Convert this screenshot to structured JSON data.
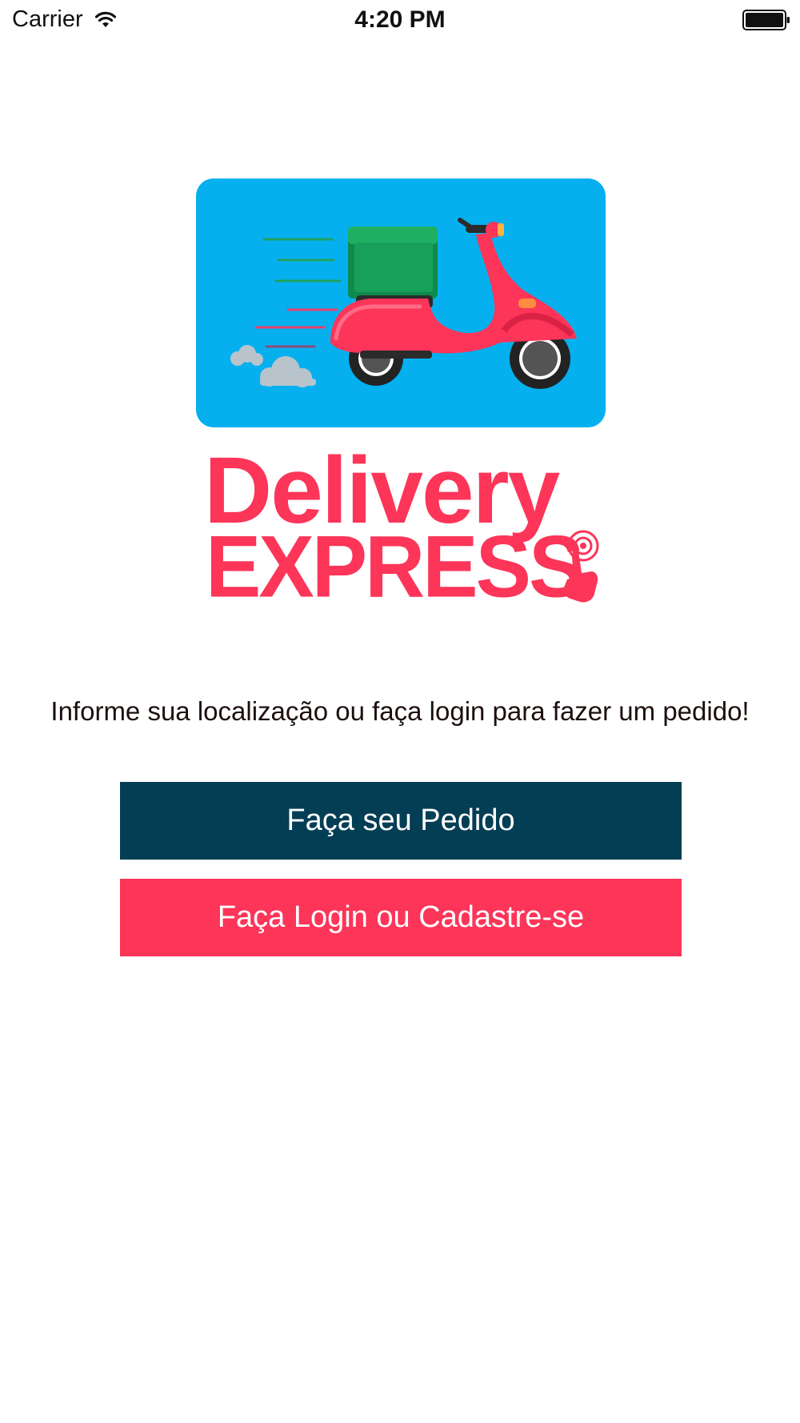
{
  "status_bar": {
    "carrier": "Carrier",
    "time": "4:20 PM"
  },
  "logo": {
    "title_line1": "Delivery",
    "title_line2": "EXPRESS",
    "card_color": "#06b0ef",
    "brand_color": "#fc3559"
  },
  "prompt": "Informe sua localização ou faça login para fazer um pedido!",
  "buttons": {
    "order": "Faça seu Pedido",
    "login": "Faça Login ou Cadastre-se"
  },
  "colors": {
    "order_button": "#033e54",
    "login_button": "#fc3559"
  },
  "icons": {
    "signal": "wifi-icon",
    "battery": "battery-icon",
    "scooter": "scooter-illustration",
    "tap": "tap-hand-icon"
  }
}
